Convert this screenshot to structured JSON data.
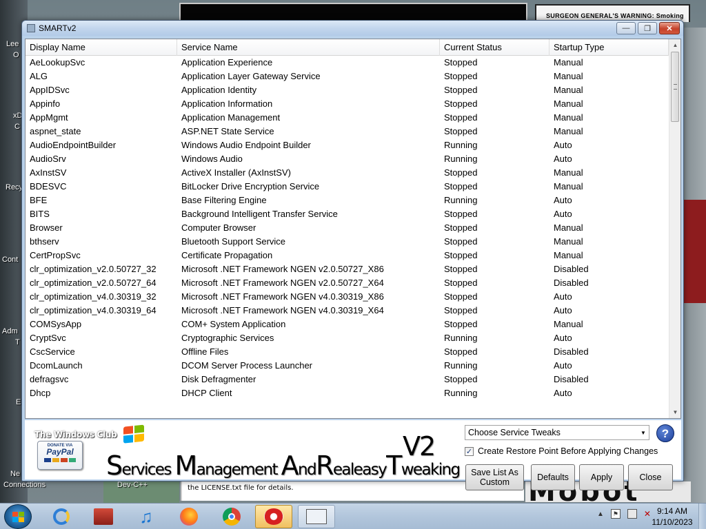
{
  "window": {
    "title": "SMARTv2",
    "min_glyph": "—",
    "max_glyph": "❐",
    "close_glyph": "✕"
  },
  "desktop": {
    "labels": [
      "Lee",
      "O",
      "xD",
      "C",
      "Recy",
      "Cont",
      "Adm",
      "T",
      "E",
      "Ne",
      "Connections",
      "Dev-C++"
    ],
    "warning_text": "SURGEON GENERAL'S WARNING: Smoking",
    "license_text": "the LICENSE.txt file for details.",
    "bg_text": "Mobot"
  },
  "table": {
    "headers": {
      "display": "Display Name",
      "service": "Service Name",
      "status": "Current Status",
      "startup": "Startup Type"
    },
    "rows": [
      [
        "AeLookupSvc",
        "Application Experience",
        "Stopped",
        "Manual"
      ],
      [
        "ALG",
        "Application Layer Gateway Service",
        "Stopped",
        "Manual"
      ],
      [
        "AppIDSvc",
        "Application Identity",
        "Stopped",
        "Manual"
      ],
      [
        "Appinfo",
        "Application Information",
        "Stopped",
        "Manual"
      ],
      [
        "AppMgmt",
        "Application Management",
        "Stopped",
        "Manual"
      ],
      [
        "aspnet_state",
        "ASP.NET State Service",
        "Stopped",
        "Manual"
      ],
      [
        "AudioEndpointBuilder",
        "Windows Audio Endpoint Builder",
        "Running",
        "Auto"
      ],
      [
        "AudioSrv",
        "Windows Audio",
        "Running",
        "Auto"
      ],
      [
        "AxInstSV",
        "ActiveX Installer (AxInstSV)",
        "Stopped",
        "Manual"
      ],
      [
        "BDESVC",
        "BitLocker Drive Encryption Service",
        "Stopped",
        "Manual"
      ],
      [
        "BFE",
        "Base Filtering Engine",
        "Running",
        "Auto"
      ],
      [
        "BITS",
        "Background Intelligent Transfer Service",
        "Stopped",
        "Auto"
      ],
      [
        "Browser",
        "Computer Browser",
        "Stopped",
        "Manual"
      ],
      [
        "bthserv",
        "Bluetooth Support Service",
        "Stopped",
        "Manual"
      ],
      [
        "CertPropSvc",
        "Certificate Propagation",
        "Stopped",
        "Manual"
      ],
      [
        "clr_optimization_v2.0.50727_32",
        "Microsoft .NET Framework NGEN v2.0.50727_X86",
        "Stopped",
        "Disabled"
      ],
      [
        "clr_optimization_v2.0.50727_64",
        "Microsoft .NET Framework NGEN v2.0.50727_X64",
        "Stopped",
        "Disabled"
      ],
      [
        "clr_optimization_v4.0.30319_32",
        "Microsoft .NET Framework NGEN v4.0.30319_X86",
        "Stopped",
        "Auto"
      ],
      [
        "clr_optimization_v4.0.30319_64",
        "Microsoft .NET Framework NGEN v4.0.30319_X64",
        "Stopped",
        "Auto"
      ],
      [
        "COMSysApp",
        "COM+ System Application",
        "Stopped",
        "Manual"
      ],
      [
        "CryptSvc",
        "Cryptographic Services",
        "Running",
        "Auto"
      ],
      [
        "CscService",
        "Offline Files",
        "Stopped",
        "Disabled"
      ],
      [
        "DcomLaunch",
        "DCOM Server Process Launcher",
        "Running",
        "Auto"
      ],
      [
        "defragsvc",
        "Disk Defragmenter",
        "Stopped",
        "Disabled"
      ],
      [
        "Dhcp",
        "DHCP Client",
        "Running",
        "Auto"
      ]
    ]
  },
  "branding": {
    "club": "The Windows Club",
    "paypal_top": "DONATE VIA",
    "paypal_name": "PayPal",
    "title_parts": [
      {
        "cap": "S",
        "rest": "ervices "
      },
      {
        "cap": "M",
        "rest": "anagement "
      },
      {
        "cap": "A",
        "rest": "nd"
      },
      {
        "cap": "R",
        "rest": "ealeasy"
      },
      {
        "cap": "T",
        "rest": "weaking"
      }
    ],
    "version": "V2"
  },
  "controls": {
    "tweaks_combo": "Choose Service Tweaks",
    "help_glyph": "?",
    "restore_point_label": "Create Restore Point Before Applying Changes",
    "restore_point_checked": true,
    "save_btn_line1": "Save List As",
    "save_btn_line2": "Custom",
    "defaults_btn": "Defaults",
    "apply_btn": "Apply",
    "close_btn": "Close"
  },
  "taskbar": {
    "time": "9:14 AM",
    "date": "11/10/2023",
    "tray_up_glyph": "▲"
  }
}
